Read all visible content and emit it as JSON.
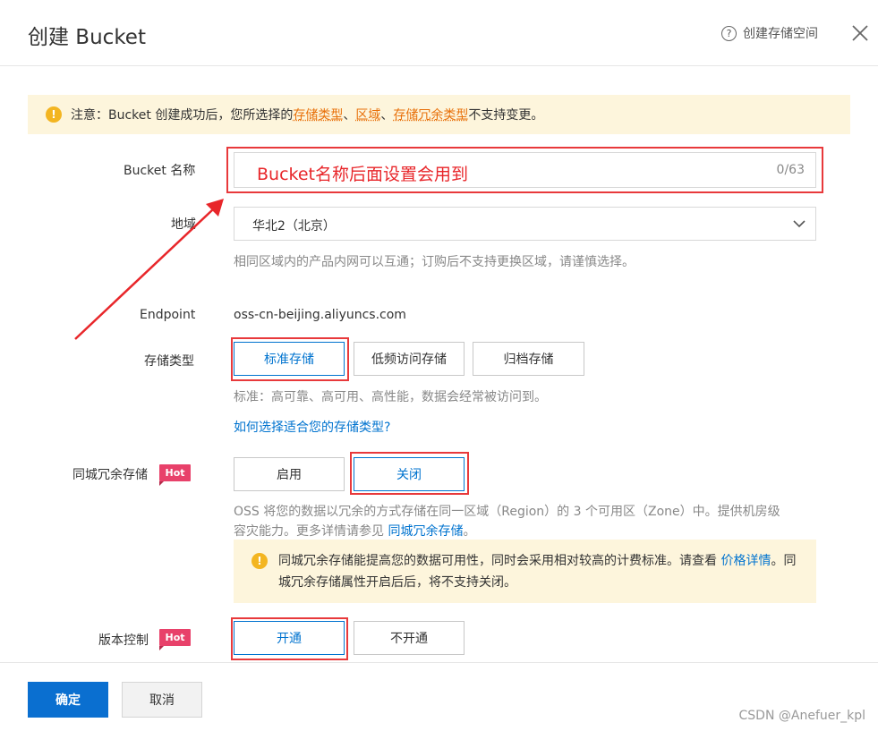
{
  "header": {
    "title": "创建 Bucket",
    "help_icon": "?",
    "help_label": "创建存储空间"
  },
  "notice": {
    "prefix": "注意：Bucket 创建成功后，您所选择的 ",
    "storage_type": "存储类型",
    "sep1": "、",
    "region": "区域",
    "sep2": "、",
    "redundancy": "存储冗余类型",
    "suffix": " 不支持变更。"
  },
  "bucket_name": {
    "label": "Bucket 名称",
    "value": "Bucket名称后面设置会用到",
    "counter": "0/63"
  },
  "region": {
    "label": "地域",
    "selected": "华北2（北京）",
    "hint": "相同区域内的产品内网可以互通；订购后不支持更换区域，请谨慎选择。"
  },
  "endpoint": {
    "label": "Endpoint",
    "value": "oss-cn-beijing.aliyuncs.com"
  },
  "storage_class": {
    "label": "存储类型",
    "options": [
      "标准存储",
      "低频访问存储",
      "归档存储"
    ],
    "hint": "标准：高可靠、高可用、高性能，数据会经常被访问到。",
    "link": "如何选择适合您的存储类型?"
  },
  "zrs": {
    "label": "同城冗余存储",
    "badge": "Hot",
    "options": [
      "启用",
      "关闭"
    ],
    "hint_line1": "OSS 将您的数据以冗余的方式存储在同一区域（Region）的 3 个可用区（Zone）中。提供机房级",
    "hint_line2": "容灾能力。更多详情请参见 ",
    "hint_link": "同城冗余存储",
    "hint_end": "。",
    "info_part1": "同城冗余存储能提高您的数据可用性，同时会采用相对较高的计费标准。请查看 ",
    "info_link": "价格详情",
    "info_part2": "。同城冗余存储属性开启后后，将不支持关闭。"
  },
  "versioning": {
    "label": "版本控制",
    "badge": "Hot",
    "options": [
      "开通",
      "不开通"
    ]
  },
  "footer": {
    "confirm": "确定",
    "cancel": "取消",
    "watermark": "CSDN @Anefuer_kpl"
  },
  "colors": {
    "primary": "#0a6fd0",
    "link": "#0073cf",
    "warning": "#f3b521",
    "highlight": "#e8393b",
    "hot_badge": "#e8416a"
  }
}
